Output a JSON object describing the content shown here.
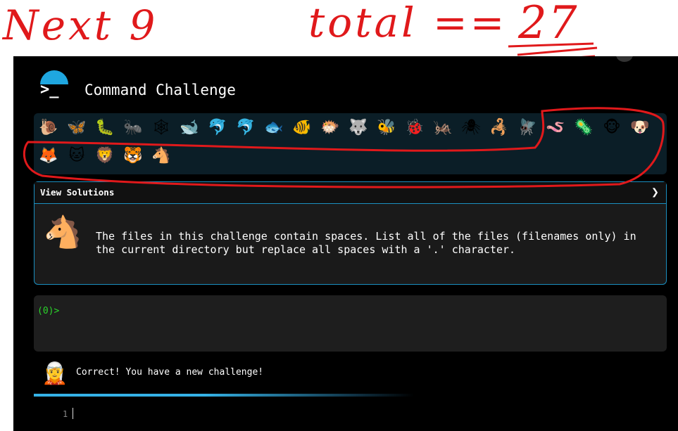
{
  "annotations": {
    "left_note": "Next 9",
    "right_note_prefix": "total ==",
    "right_note_value": "27"
  },
  "header": {
    "title": "Command Challenge",
    "terminal_glyph": ">_"
  },
  "challenge_icons": [
    "🐌",
    "🦋",
    "🐛",
    "🐜",
    "🕸",
    "🐋",
    "🐬",
    "🐬",
    "🐟",
    "🐠",
    "🐡",
    "🐺",
    "🐝",
    "🐞",
    "🦗",
    "🕷",
    "🦂",
    "🪰",
    "🪱",
    "🦠",
    "🐵",
    "🐶",
    "🦊",
    "🐱",
    "🦁",
    "🐯",
    "🐴"
  ],
  "solutions_panel": {
    "header_label": "View Solutions",
    "chevron": "❯",
    "icon": "🐴",
    "description": "The files in this challenge contain spaces. List all of the files (filenames only) in the current directory but replace all spaces with a '.' character."
  },
  "terminal": {
    "prompt": "(0)>"
  },
  "notice": {
    "avatar": "🧝",
    "text": "Correct! You have a new challenge!"
  },
  "editor": {
    "line_number": "1"
  },
  "colors": {
    "accent": "#1b8fc0",
    "annotation_red": "#e0191b",
    "prompt_green": "#2bd42b"
  }
}
